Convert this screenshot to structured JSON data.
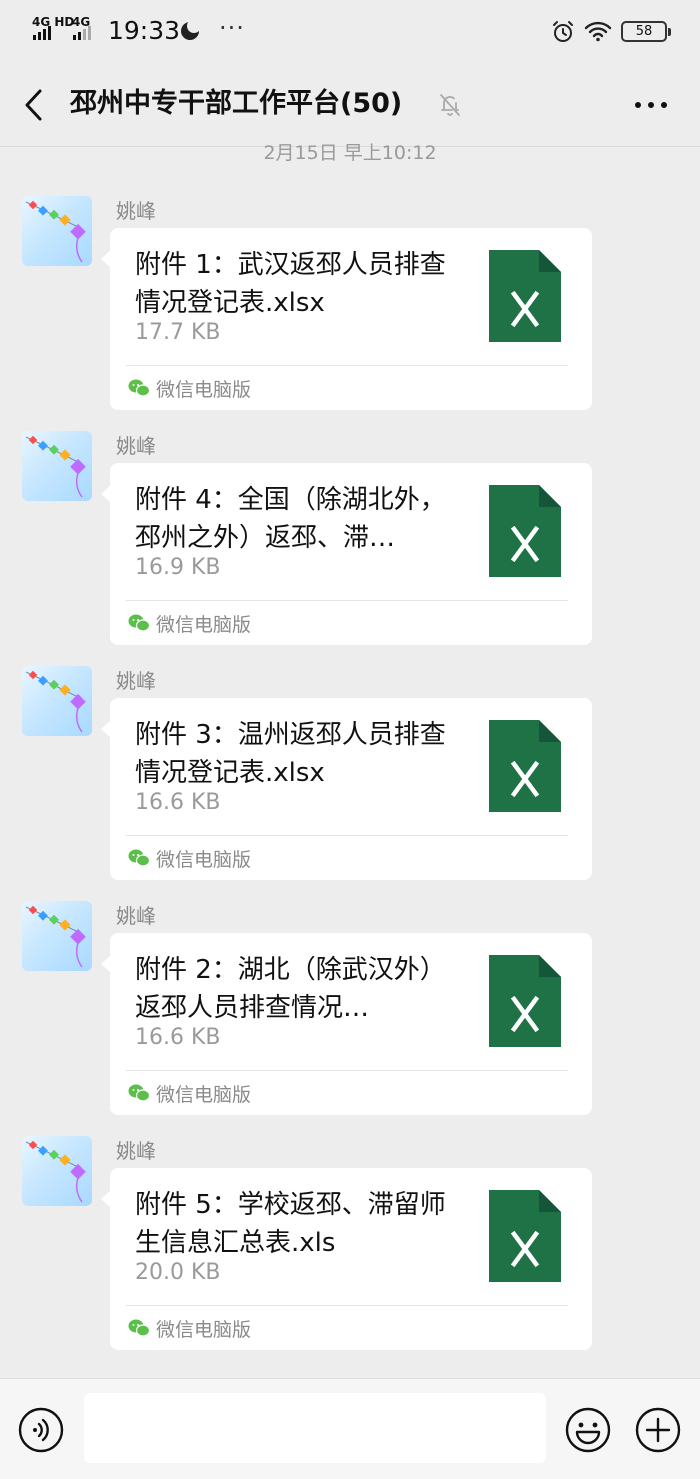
{
  "status_bar": {
    "network_1": "4G HD",
    "network_2": "4G",
    "time": "19:33",
    "more": "···",
    "battery": "58"
  },
  "header": {
    "title": "邳州中专干部工作平台(50)",
    "back_icon": "chevron-left-icon",
    "mute_icon": "bell-off-icon",
    "more_icon": "ellipsis-icon"
  },
  "timestamp": "2月15日 早上10:12",
  "messages": [
    {
      "sender": "姚峰",
      "file_name": "附件 1：武汉返邳人员排查情况登记表.xlsx",
      "file_size": "17.7 KB",
      "source": "微信电脑版"
    },
    {
      "sender": "姚峰",
      "file_name": "附件 4：全国（除湖北外，邳州之外）返邳、滞…",
      "file_size": "16.9 KB",
      "source": "微信电脑版"
    },
    {
      "sender": "姚峰",
      "file_name": "附件 3：温州返邳人员排查情况登记表.xlsx",
      "file_size": "16.6 KB",
      "source": "微信电脑版"
    },
    {
      "sender": "姚峰",
      "file_name": "附件 2：湖北（除武汉外）返邳人员排查情况…",
      "file_size": "16.6 KB",
      "source": "微信电脑版"
    },
    {
      "sender": "姚峰",
      "file_name": "附件 5：学校返邳、滞留师生信息汇总表.xls",
      "file_size": "20.0 KB",
      "source": "微信电脑版"
    }
  ],
  "input_bar": {
    "value": "",
    "voice_icon": "voice-icon",
    "emoji_icon": "emoji-icon",
    "plus_icon": "plus-icon"
  },
  "colors": {
    "background": "#ededed",
    "bubble": "#ffffff",
    "excel_green": "#1f7246",
    "wechat_green": "#5bbf4a"
  }
}
